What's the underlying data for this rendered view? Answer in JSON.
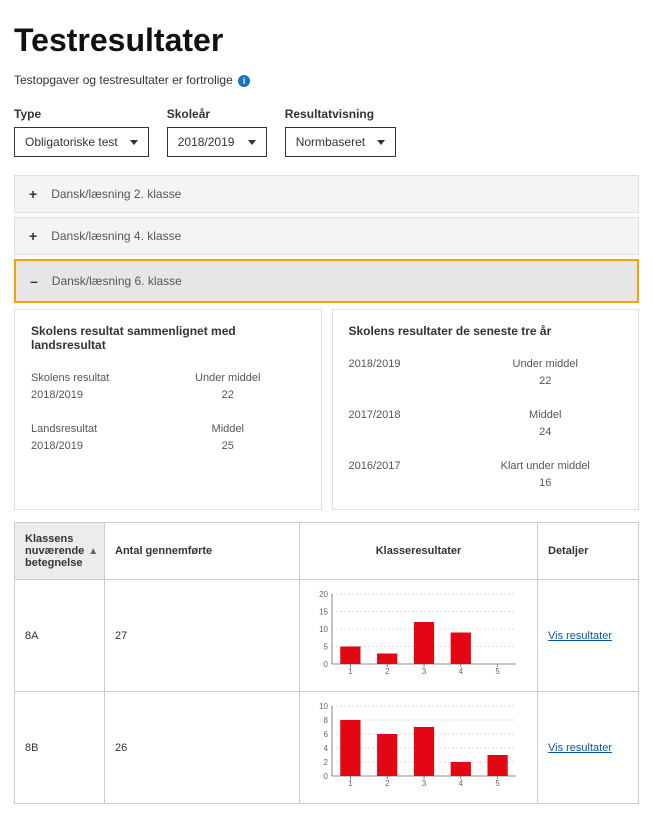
{
  "page": {
    "title": "Testresultater",
    "subtitle": "Testopgaver og testresultater er fortrolige"
  },
  "filters": {
    "type": {
      "label": "Type",
      "value": "Obligatoriske test"
    },
    "year": {
      "label": "Skoleår",
      "value": "2018/2019"
    },
    "view": {
      "label": "Resultatvisning",
      "value": "Normbaseret"
    }
  },
  "accordion": {
    "items": [
      {
        "label": "Dansk/læsning 2. klasse",
        "expanded": false
      },
      {
        "label": "Dansk/læsning 4. klasse",
        "expanded": false
      },
      {
        "label": "Dansk/læsning 6. klasse",
        "expanded": true
      }
    ]
  },
  "panel_left": {
    "title": "Skolens resultat sammenlignet med landsresultat",
    "rows": [
      {
        "label_line1": "Skolens resultat",
        "label_line2": "2018/2019",
        "value_line1": "Under middel",
        "value_line2": "22"
      },
      {
        "label_line1": "Landsresultat",
        "label_line2": "2018/2019",
        "value_line1": "Middel",
        "value_line2": "25"
      }
    ]
  },
  "panel_right": {
    "title": "Skolens resultater de seneste tre år",
    "rows": [
      {
        "label_line1": "2018/2019",
        "value_line1": "Under middel",
        "value_line2": "22"
      },
      {
        "label_line1": "2017/2018",
        "value_line1": "Middel",
        "value_line2": "24"
      },
      {
        "label_line1": "2016/2017",
        "value_line1": "Klart under middel",
        "value_line2": "16"
      }
    ]
  },
  "table": {
    "headers": {
      "c1": "Klassens nuværende betegnelse",
      "c2": "Antal gennemførte",
      "c3": "Klasseresultater",
      "c4": "Detaljer"
    },
    "detail_link_label": "Vis resultater",
    "rows": [
      {
        "klasse": "8A",
        "antal": "27"
      },
      {
        "klasse": "8B",
        "antal": "26"
      }
    ]
  },
  "chart_data": [
    {
      "type": "bar",
      "title": "",
      "xlabel": "",
      "ylabel": "",
      "categories": [
        "1",
        "2",
        "3",
        "4",
        "5"
      ],
      "values": [
        5,
        3,
        12,
        9,
        0
      ],
      "ylim": [
        0,
        20
      ],
      "yticks": [
        0,
        5,
        10,
        15,
        20
      ]
    },
    {
      "type": "bar",
      "title": "",
      "xlabel": "",
      "ylabel": "",
      "categories": [
        "1",
        "2",
        "3",
        "4",
        "5"
      ],
      "values": [
        8,
        6,
        7,
        2,
        3
      ],
      "ylim": [
        0,
        10
      ],
      "yticks": [
        0,
        2,
        4,
        6,
        8,
        10
      ]
    }
  ]
}
